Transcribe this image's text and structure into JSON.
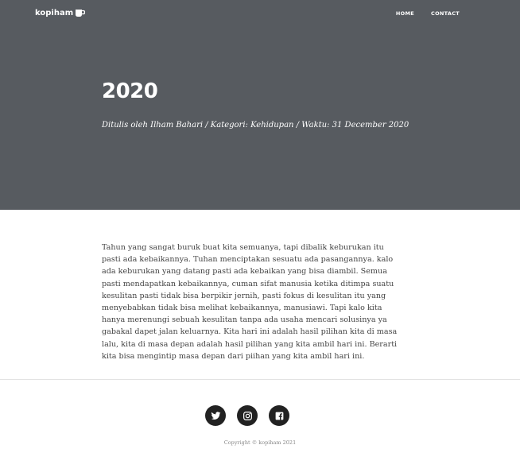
{
  "header": {
    "brand": "kopiham",
    "brand_icon": "coffee-cup-icon",
    "nav": [
      {
        "label": "HOME"
      },
      {
        "label": "CONTACT"
      }
    ]
  },
  "post": {
    "title": "2020",
    "meta": "Ditulis oleh Ilham Bahari / Kategori: Kehidupan / Waktu: 31 December 2020",
    "body": "Tahun yang sangat buruk buat kita semuanya, tapi dibalik keburukan itu pasti ada kebaikannya. Tuhan menciptakan sesuatu ada pasangannya. kalo ada keburukan yang datang pasti ada kebaikan yang bisa diambil. Semua pasti mendapatkan kebaikannya, cuman sifat manusia ketika ditimpa suatu kesulitan pasti tidak bisa berpikir jernih, pasti fokus di kesulitan itu yang menyebabkan tidak bisa melihat kebaikannya, manusiawi. Tapi kalo kita hanya merenungi sebuah kesulitan tanpa ada usaha mencari solusinya ya gabakal dapet jalan keluarnya. Kita hari ini adalah hasil pilihan kita di masa lalu, kita di masa depan adalah hasil pilihan yang kita ambil hari ini. Berarti kita bisa mengintip masa depan dari piihan yang kita ambil hari ini."
  },
  "footer": {
    "socials": [
      "twitter-icon",
      "instagram-icon",
      "facebook-icon"
    ],
    "copyright": "Copyright © kopiham 2021"
  },
  "colors": {
    "hero_bg": "#575b60",
    "icon_bg": "#222222"
  }
}
